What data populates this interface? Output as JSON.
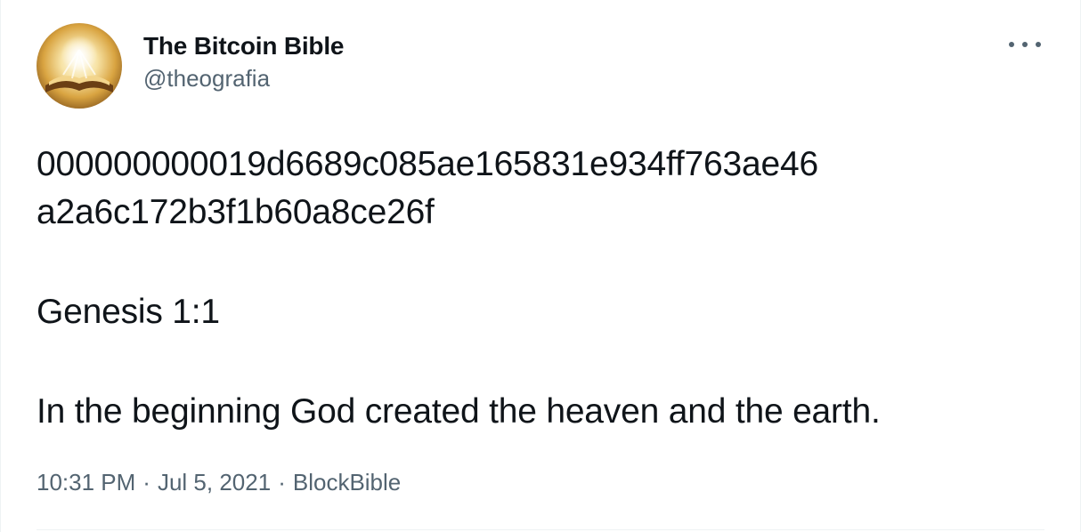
{
  "tweet": {
    "author": {
      "display_name": "The Bitcoin Bible",
      "handle": "@theografia",
      "avatar_icon": "glowing-open-book-icon"
    },
    "more_icon": "more-horizontal-icon",
    "text": {
      "hash_line_1": "000000000019d6689c085ae165831e934ff763ae46",
      "hash_line_2": "a2a6c172b3f1b60a8ce26f",
      "reference": "Genesis 1:1",
      "verse": "In the beginning God created the heaven and the earth."
    },
    "meta": {
      "time": "10:31 PM",
      "separator": "·",
      "date": "Jul 5, 2021",
      "source": "BlockBible"
    }
  },
  "colors": {
    "text_primary": "#0f1419",
    "text_secondary": "#536471",
    "border": "#eff3f4",
    "avatar_gold": "#e8b84a"
  }
}
